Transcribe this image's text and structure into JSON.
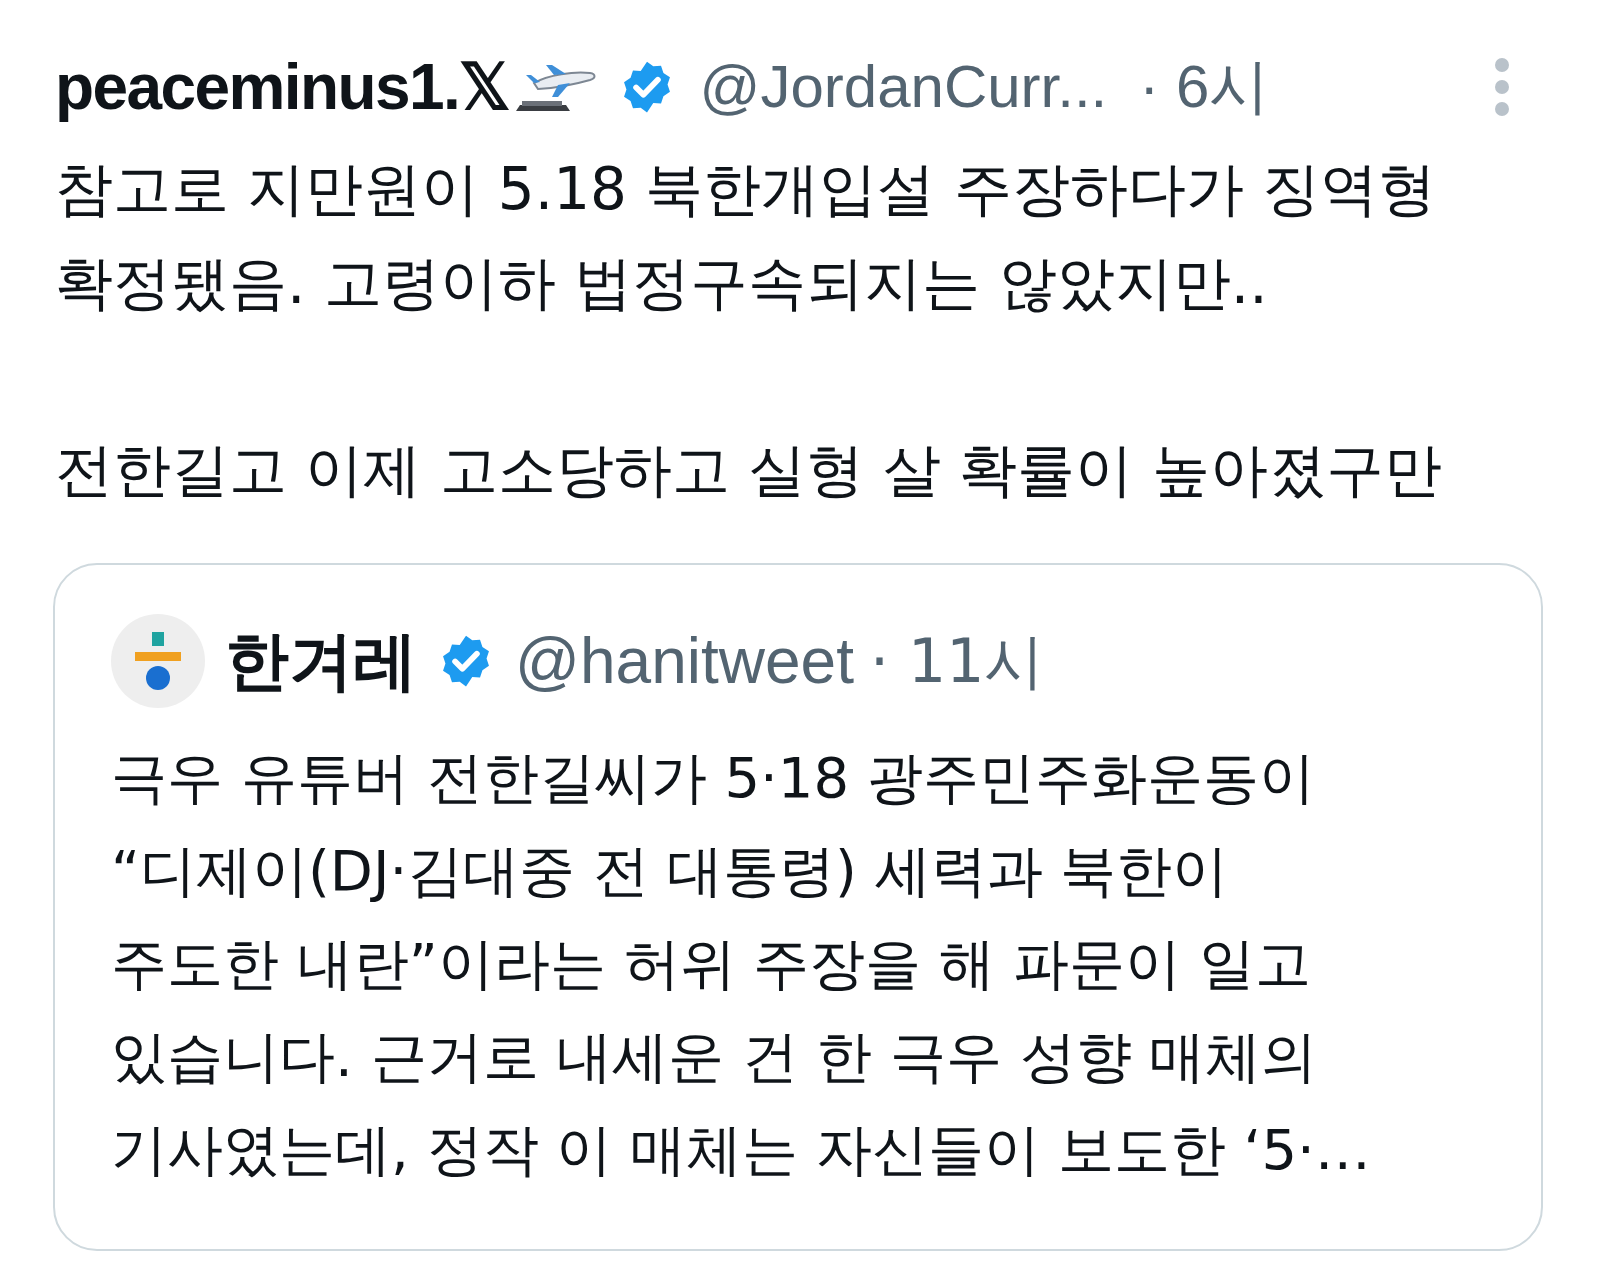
{
  "tweet": {
    "display_name": "peaceminus1.𝕏",
    "verified": true,
    "handle": "@JordanCurr...",
    "time": "· 6시",
    "paragraphs": [
      [
        "참고로 지만원이 5.18 북한개입설 주장하다가 징역형",
        "확정됐음. 고령이하 법정구속되지는 않았지만.."
      ],
      [
        "전한길고 이제 고소당하고 실형 살 확률이 높아졌구만"
      ]
    ],
    "quote": {
      "display_name": "한겨레",
      "verified": true,
      "handle": "@hanitweet",
      "time": "· 11시",
      "lines": [
        "극우 유튜버 전한길씨가 5·18 광주민주화운동이",
        "“디제이(DJ·김대중 전 대통령) 세력과 북한이",
        "주도한 내란”이라는 허위 주장을 해 파문이 일고",
        "있습니다. 근거로 내세운 건 한 극우 성향 매체의",
        "기사였는데, 정작 이 매체는 자신들이 보도한 ‘5·…"
      ]
    }
  }
}
